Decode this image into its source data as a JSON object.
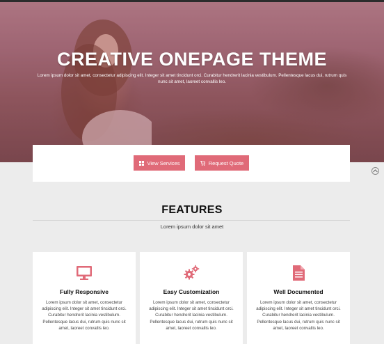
{
  "hero": {
    "title": "CREATIVE ONEPAGE THEME",
    "subtitle": "Lorem ipsum dolor sit amet, consectetur adipiscing elit. Integer sit amet tincidunt orci. Curabitur hendrerit lacinia vestibulum. Pellentesque lacus dui, rutrum quis nunc sit amet, laoreet convallis leo."
  },
  "cta": {
    "view_services": "View Services",
    "request_quote": "Request Quote"
  },
  "features": {
    "title": "FEATURES",
    "subtitle": "Lorem ipsum dolor sit amet",
    "items": [
      {
        "icon": "monitor-icon",
        "title": "Fully Responsive",
        "text": "Lorem ipsum dolor sit amet, consectetur adipiscing elit. Integer sit amet tincidunt orci. Curabitur hendrerit lacinia vestibulum. Pellentesque lacus dui, rutrum quis nunc sit amet, laoreet convallis leo."
      },
      {
        "icon": "gears-icon",
        "title": "Easy Customization",
        "text": "Lorem ipsum dolor sit amet, consectetur adipiscing elit. Integer sit amet tincidunt orci. Curabitur hendrerit lacinia vestibulum. Pellentesque lacus dui, rutrum quis nunc sit amet, laoreet convallis leo."
      },
      {
        "icon": "document-icon",
        "title": "Well Documented",
        "text": "Lorem ipsum dolor sit amet, consectetur adipiscing elit. Integer sit amet tincidunt orci. Curabitur hendrerit lacinia vestibulum. Pellentesque lacus dui, rutrum quis nunc sit amet, laoreet convallis leo."
      }
    ]
  },
  "colors": {
    "accent": "#e06a78",
    "background": "#ececec",
    "card": "#ffffff"
  }
}
